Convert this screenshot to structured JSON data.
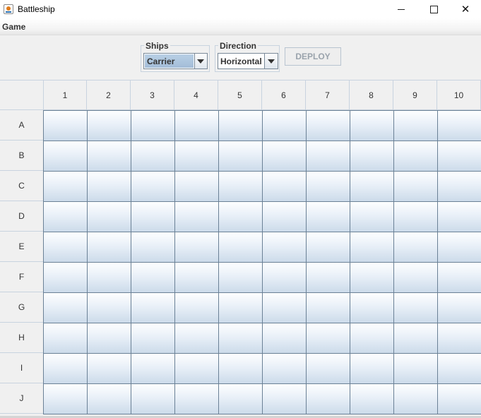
{
  "window": {
    "title": "Battleship",
    "icon": "java-icon",
    "controls": [
      "minimize-icon",
      "maximize-icon",
      "close-icon"
    ]
  },
  "menu": {
    "items": [
      "Game"
    ]
  },
  "toolbar": {
    "ships": {
      "legend": "Ships",
      "selected": "Carrier"
    },
    "direction": {
      "legend": "Direction",
      "selected": "Horizontal"
    },
    "deploy_label": "DEPLOY"
  },
  "board": {
    "columns": [
      "1",
      "2",
      "3",
      "4",
      "5",
      "6",
      "7",
      "8",
      "9",
      "10"
    ],
    "rows": [
      "A",
      "B",
      "C",
      "D",
      "E",
      "F",
      "G",
      "H",
      "I",
      "J"
    ]
  }
}
